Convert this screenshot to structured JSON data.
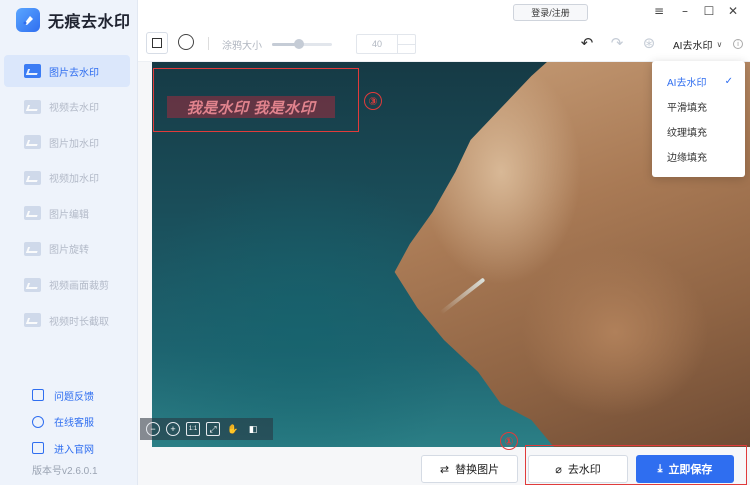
{
  "app": {
    "name": "无痕去水印",
    "version": "版本号v2.6.0.1"
  },
  "topbar": {
    "login": "登录/注册",
    "menu_icon": "≡",
    "minimize_icon": "–",
    "maximize_icon": "☐",
    "close_icon": "✕"
  },
  "sidebar": {
    "items": [
      {
        "label": "图片去水印",
        "active": true
      },
      {
        "label": "视频去水印",
        "active": false
      },
      {
        "label": "图片加水印",
        "active": false
      },
      {
        "label": "视频加水印",
        "active": false
      },
      {
        "label": "图片编辑",
        "active": false
      },
      {
        "label": "图片旋转",
        "active": false
      },
      {
        "label": "视频画面裁剪",
        "active": false
      },
      {
        "label": "视频时长截取",
        "active": false
      }
    ],
    "bottom_links": [
      {
        "label": "问题反馈",
        "icon": "feedback-icon"
      },
      {
        "label": "在线客服",
        "icon": "service-icon"
      },
      {
        "label": "进入官网",
        "icon": "website-icon"
      }
    ]
  },
  "toolbar": {
    "brush_label": "涂鸦大小",
    "brush_value": "40",
    "brush_level": 0.45,
    "mode": "AI去水印",
    "mode_chevron": "∨",
    "undo_icon": "↶",
    "redo_icon": "↷",
    "compare_icon": "⊛",
    "info_icon": "i"
  },
  "dropdown": {
    "options": [
      "AI去水印",
      "平滑填充",
      "纹理填充",
      "边缘填充"
    ],
    "selected": "AI去水印",
    "check_icon": "✓"
  },
  "canvas": {
    "watermark_text": "我是水印 我是水印",
    "callout_top": "③",
    "callout_bottom": "①",
    "zoom_tools": [
      "−",
      "+",
      "1:1",
      "⤢",
      "✋",
      "◧"
    ]
  },
  "actions": {
    "replace": "替换图片",
    "replace_icon": "⇄",
    "remove": "去水印",
    "remove_icon": "⌀",
    "save": "立即保存",
    "save_icon": "⤓"
  },
  "colors": {
    "accent": "#2f6ef0",
    "highlight": "#e03b3b",
    "sidebar_bg": "#eef3fb"
  }
}
